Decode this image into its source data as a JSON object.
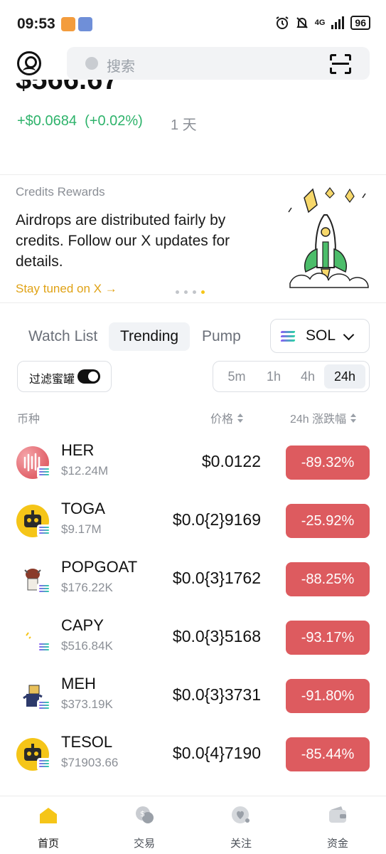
{
  "status_bar": {
    "time": "09:53",
    "network": "4G",
    "battery": "96"
  },
  "header": {
    "search_placeholder": "搜索"
  },
  "portfolio": {
    "balance": "$566.67",
    "change_amount": "+$0.0684",
    "change_percent": "(+0.02%)",
    "change_period": "1 天",
    "change_color": "#2eb36b"
  },
  "banner": {
    "label": "Credits Rewards",
    "text": "Airdrops are distributed fairly by credits. Follow our X updates for details.",
    "link": "Stay tuned on X",
    "link_arrow": "→",
    "slide_count": 4,
    "active_slide": 4
  },
  "tabs": [
    "Watch List",
    "Trending",
    "Pump"
  ],
  "active_tab": "Trending",
  "chain_selector": {
    "value": "SOL"
  },
  "filter": {
    "label": "过滤蜜罐",
    "enabled": true
  },
  "timeframes": [
    "5m",
    "1h",
    "4h",
    "24h"
  ],
  "active_timeframe": "24h",
  "table": {
    "col_coin": "币种",
    "col_price": "价格",
    "col_change": "24h 涨跌幅",
    "rows": [
      {
        "name": "HER",
        "market_cap": "$12.24M",
        "price": "$0.0122",
        "change": "-89.32%"
      },
      {
        "name": "TOGA",
        "market_cap": "$9.17M",
        "price": "$0.0{2}9169",
        "change": "-25.92%"
      },
      {
        "name": "POPGOAT",
        "market_cap": "$176.22K",
        "price": "$0.0{3}1762",
        "change": "-88.25%"
      },
      {
        "name": "CAPY",
        "market_cap": "$516.84K",
        "price": "$0.0{3}5168",
        "change": "-93.17%"
      },
      {
        "name": "MEH",
        "market_cap": "$373.19K",
        "price": "$0.0{3}3731",
        "change": "-91.80%"
      },
      {
        "name": "TESOL",
        "market_cap": "$71903.66",
        "price": "$0.0{4}7190",
        "change": "-85.44%"
      }
    ]
  },
  "colors": {
    "accent_yellow": "#f5c518",
    "negative_badge": "#dd5b5f",
    "link_gold": "#e0a215"
  },
  "bottom_nav": [
    {
      "label": "首页",
      "icon": "home-icon",
      "active": true
    },
    {
      "label": "交易",
      "icon": "trade-icon",
      "active": false
    },
    {
      "label": "关注",
      "icon": "follow-icon",
      "active": false
    },
    {
      "label": "资金",
      "icon": "wallet-icon",
      "active": false
    }
  ]
}
